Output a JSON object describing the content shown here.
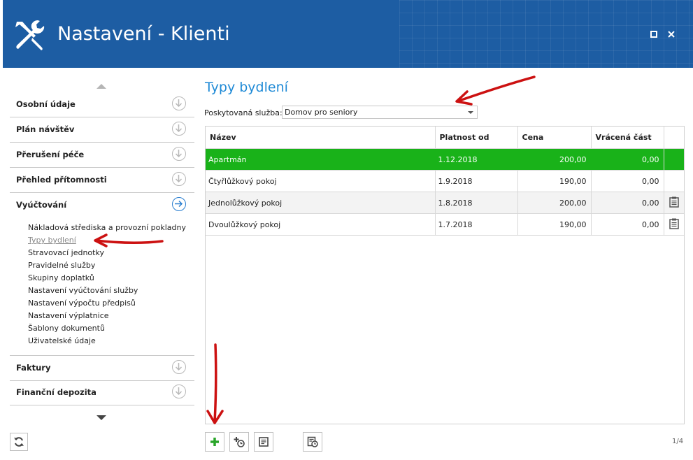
{
  "window": {
    "title": "Nastavení - Klienti",
    "accent_color": "#1d5da3",
    "icon": "wrench-screwdriver-icon"
  },
  "sidebar": {
    "sections": [
      {
        "label": "Osobní údaje",
        "icon": "arrow-down-circle-icon"
      },
      {
        "label": "Plán návštěv",
        "icon": "arrow-down-circle-icon"
      },
      {
        "label": "Přerušení péče",
        "icon": "arrow-down-circle-icon"
      },
      {
        "label": "Přehled přítomnosti",
        "icon": "arrow-down-circle-icon"
      },
      {
        "label": "Vyúčtování",
        "icon": "arrow-right-circle-icon",
        "active": true
      },
      {
        "label": "Faktury",
        "icon": "arrow-down-circle-icon"
      },
      {
        "label": "Finanční depozita",
        "icon": "arrow-down-circle-icon"
      }
    ],
    "subitems": [
      "Nákladová střediska a provozní pokladny",
      "Typy bydlení",
      "Stravovací jednotky",
      "Pravidelné služby",
      "Skupiny doplatků",
      "Nastavení vyúčtování služby",
      "Nastavení výpočtu předpisů",
      "Nastavení výplatnice",
      "Šablony dokumentů",
      "Uživatelské údaje"
    ],
    "selected_subitem": "Typy bydlení"
  },
  "main": {
    "title": "Typy bydlení",
    "service_label": "Poskytovaná služba:",
    "service_value": "Domov pro seniory",
    "table": {
      "columns": [
        "Název",
        "Platnost od",
        "Cena",
        "Vrácená část",
        ""
      ],
      "rows": [
        {
          "name": "Apartmán",
          "valid_from": "1.12.2018",
          "price": "200,00",
          "refund": "0,00",
          "has_icon": false,
          "selected": true
        },
        {
          "name": "Čtyřlůžkový pokoj",
          "valid_from": "1.9.2018",
          "price": "190,00",
          "refund": "0,00",
          "has_icon": false
        },
        {
          "name": "Jednolůžkový pokoj",
          "valid_from": "1.8.2018",
          "price": "200,00",
          "refund": "0,00",
          "has_icon": true
        },
        {
          "name": "Dvoulůžkový pokoj",
          "valid_from": "1.7.2018",
          "price": "190,00",
          "refund": "0,00",
          "has_icon": true
        }
      ],
      "selected_color": "#19b219"
    },
    "toolbar": [
      "add-icon",
      "add-with-date-icon",
      "edit-document-icon",
      "history-icon"
    ],
    "pager": "1/4"
  },
  "annotation_color": "#cc1111"
}
